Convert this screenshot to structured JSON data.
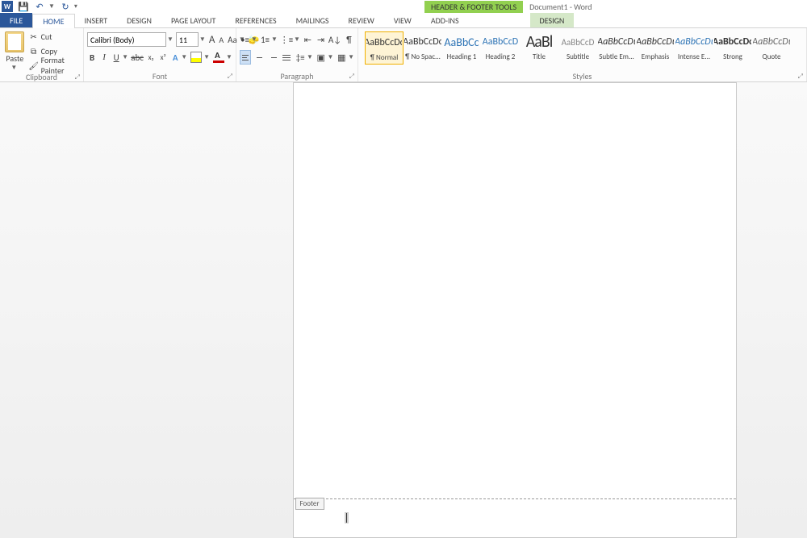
{
  "title": {
    "contextual": "HEADER & FOOTER TOOLS",
    "doc": "Document1 - Word"
  },
  "qat": {
    "save": "💾",
    "undo": "↶",
    "redo": "↻",
    "custom": "▾"
  },
  "tabs": {
    "file": "FILE",
    "home": "HOME",
    "insert": "INSERT",
    "design": "DESIGN",
    "pagelayout": "PAGE LAYOUT",
    "references": "REFERENCES",
    "mailings": "MAILINGS",
    "review": "REVIEW",
    "view": "VIEW",
    "addins": "ADD-INS",
    "ctx_design": "DESIGN"
  },
  "clipboard": {
    "paste": "Paste",
    "cut": "Cut",
    "copy": "Copy",
    "formatpainter": "Format Painter",
    "group": "Clipboard"
  },
  "font": {
    "name": "Calibri (Body)",
    "size": "11",
    "growA": "A",
    "shrinkA": "A",
    "changecase": "Aa",
    "clear": "🧽",
    "bold": "B",
    "italic": "I",
    "underline": "U",
    "strike": "abc",
    "sub": "x₂",
    "sup": "x²",
    "group": "Font"
  },
  "paragraph": {
    "group": "Paragraph",
    "pilcrow": "¶"
  },
  "styles": {
    "group": "Styles",
    "items": [
      {
        "preview": "AaBbCcDc",
        "name": "¶ Normal",
        "cls": ""
      },
      {
        "preview": "AaBbCcDc",
        "name": "¶ No Spac...",
        "cls": ""
      },
      {
        "preview": "AaBbCc",
        "name": "Heading 1",
        "cls": "h1"
      },
      {
        "preview": "AaBbCcD",
        "name": "Heading 2",
        "cls": "h2"
      },
      {
        "preview": "AaBl",
        "name": "Title",
        "cls": "title"
      },
      {
        "preview": "AaBbCcD",
        "name": "Subtitle",
        "cls": "subtitle"
      },
      {
        "preview": "AaBbCcDι",
        "name": "Subtle Em...",
        "cls": "emph"
      },
      {
        "preview": "AaBbCcDι",
        "name": "Emphasis",
        "cls": "emph"
      },
      {
        "preview": "AaBbCcDι",
        "name": "Intense E...",
        "cls": "intense-e"
      },
      {
        "preview": "AaBbCcDc",
        "name": "Strong",
        "cls": "strong"
      },
      {
        "preview": "AaBbCcDι",
        "name": "Quote",
        "cls": "quote"
      }
    ]
  },
  "footer": {
    "label": "Footer"
  }
}
